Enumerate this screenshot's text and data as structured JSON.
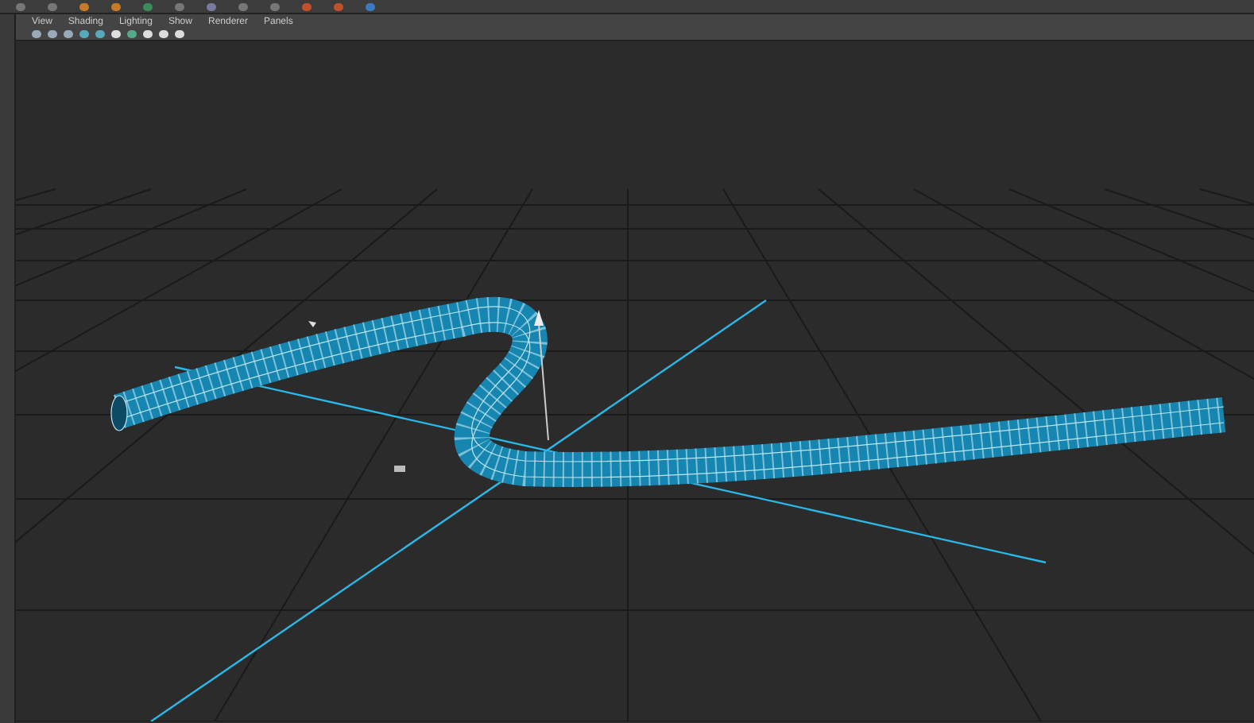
{
  "panel_menu": [
    {
      "label": "View"
    },
    {
      "label": "Shading"
    },
    {
      "label": "Lighting"
    },
    {
      "label": "Show"
    },
    {
      "label": "Renderer"
    },
    {
      "label": "Panels"
    }
  ]
}
